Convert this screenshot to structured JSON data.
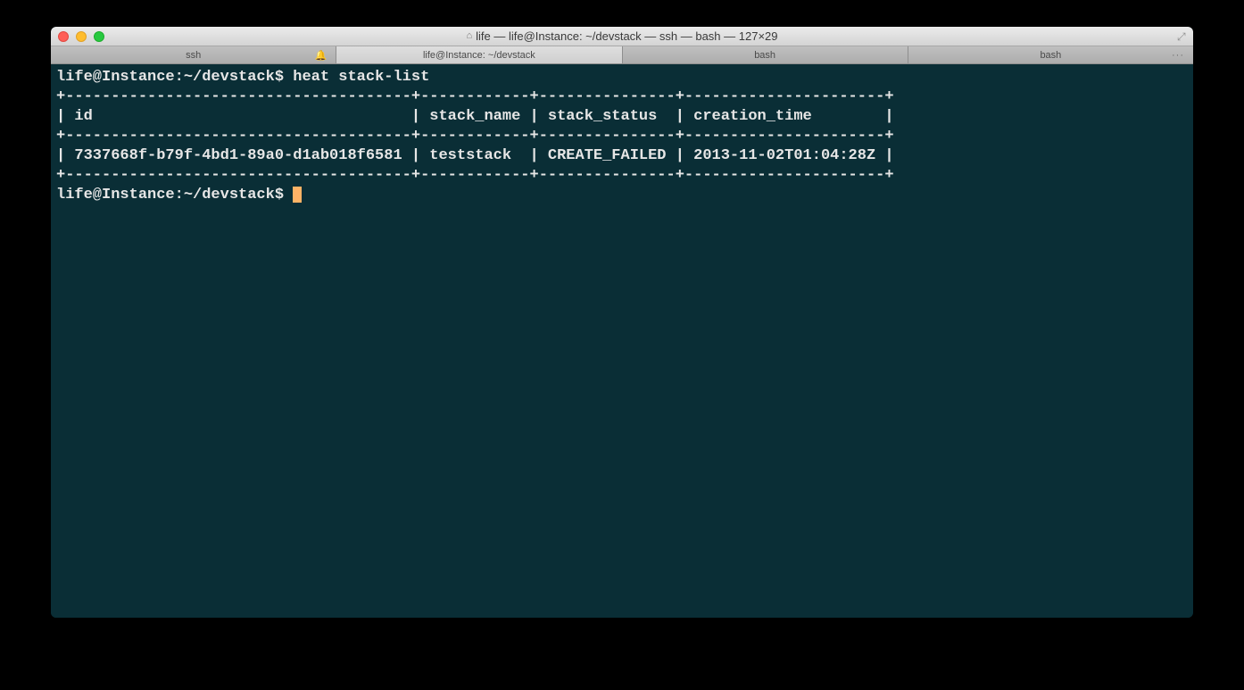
{
  "window": {
    "title": "life — life@Instance: ~/devstack — ssh — bash — 127×29"
  },
  "tabs": [
    {
      "label": "ssh",
      "active": false,
      "notification": true
    },
    {
      "label": "life@Instance: ~/devstack",
      "active": true
    },
    {
      "label": "bash",
      "active": false
    },
    {
      "label": "bash",
      "active": false,
      "overflow": true
    }
  ],
  "terminal": {
    "prompt": "life@Instance:~/devstack$ ",
    "command": "heat stack-list",
    "table": {
      "border": "+--------------------------------------+------------+---------------+----------------------+",
      "header": "| id                                   | stack_name | stack_status  | creation_time        |",
      "row": "| 7337668f-b79f-4bd1-89a0-d1ab018f6581 | teststack  | CREATE_FAILED | 2013-11-02T01:04:28Z |"
    },
    "prompt2": "life@Instance:~/devstack$ "
  }
}
